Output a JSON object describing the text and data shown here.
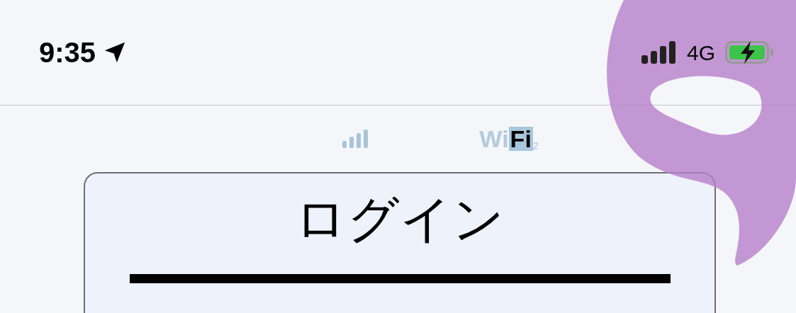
{
  "status_bar": {
    "time": "9:35",
    "network": "4G"
  },
  "connection_row": {
    "wifi_logo": {
      "left": "Wi",
      "right": "Fi",
      "subscript": "2"
    }
  },
  "login_card": {
    "title": "ログイン"
  }
}
